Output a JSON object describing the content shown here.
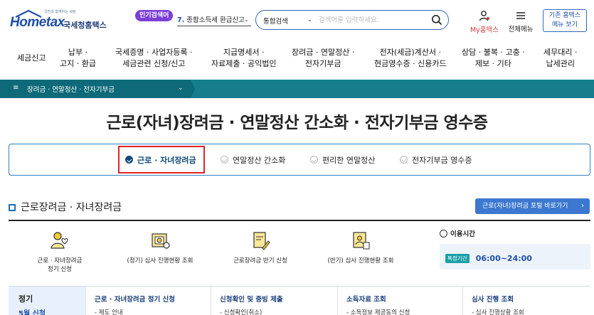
{
  "header": {
    "logo": {
      "tagline": "국민과 함께하는 세정",
      "brand_main": "Hometax",
      "brand_kr": "국세청홈택스"
    },
    "popular": {
      "badge": "인기검색어",
      "rank": "7.",
      "term": "종합소득세 환급신고",
      "chevron_icon": "chevron-down-icon"
    },
    "search": {
      "select_label": "통합검색",
      "placeholder": "검색어를 입력하세요.",
      "icon": "search-icon"
    },
    "mytax": {
      "label": "My홈택스",
      "icon": "user-icon"
    },
    "allmenu": {
      "label": "전체메뉴",
      "icon": "hamburger-icon"
    },
    "classic_button": {
      "line1": "기존 홈택스",
      "line2": "메뉴 보기"
    }
  },
  "mainnav": {
    "items": [
      {
        "line1": "세금신고",
        "line2": ""
      },
      {
        "line1": "납부 ·",
        "line2": "고지 · 환급"
      },
      {
        "line1": "국세증명 · 사업자등록 ·",
        "line2": "세금관련 신청/신고"
      },
      {
        "line1": "지급명세서 ·",
        "line2": "자료제출 · 공익법인"
      },
      {
        "line1": "장려금 · 연말정산 ·",
        "line2": "전자기부금"
      },
      {
        "line1": "전자(세금)계산서 ·",
        "line2": "현금영수증 · 신용카드"
      },
      {
        "line1": "상담 · 불복 · 고충 ·",
        "line2": "제보 · 기타"
      },
      {
        "line1": "세무대리 ·",
        "line2": "납세관리"
      }
    ]
  },
  "breadcrumb": {
    "menu_icon": "≡",
    "text": "장려금 · 연말정산 · 전자기부금",
    "chevron": "⌄"
  },
  "page_title": "근로(자녀)장려금 · 연말정산 간소화 · 전자기부금 영수증",
  "tabs": [
    {
      "label": "근로 · 자녀장려금",
      "active": true
    },
    {
      "label": "연말정산 간소화",
      "active": false
    },
    {
      "label": "편리한 연말정산",
      "active": false
    },
    {
      "label": "전자기부금 영수증",
      "active": false
    }
  ],
  "section": {
    "title": "근로장려금 · 자녀장려금",
    "shortcut_label": "근로(자녀)장려금 포털 바로가기",
    "shortcut_chevron": "›"
  },
  "services": [
    {
      "line1": "근로 · 자녀장려금",
      "line2": "정기 신청",
      "icon": "person-heart-icon"
    },
    {
      "line1": "(정기) 심사 진행현황 조회",
      "line2": "",
      "icon": "document-search-icon"
    },
    {
      "line1": "근로장려금 반기 신청",
      "line2": "",
      "icon": "document-pen-icon"
    },
    {
      "line1": "(반기) 심사 진행현황 조회",
      "line2": "",
      "icon": "document-person-icon"
    }
  ],
  "usage": {
    "title": "이용시간",
    "tag": "특정기간",
    "time": "06:00~24:00",
    "icon": "clock-icon"
  },
  "bottom": {
    "left": {
      "title": "정기",
      "period": "5월 신청"
    },
    "columns": [
      {
        "heading": "근로 · 자녀장려금 정기 신청",
        "sub": "- 제도 안내"
      },
      {
        "heading": "신청확인 및 증빙 제출",
        "sub": "- 신청확인(취소)"
      },
      {
        "heading": "소득자료 조회",
        "sub": "- 소득정보 제공동의 신청"
      },
      {
        "heading": "심사 진행 조회",
        "sub": "- 심사 진행상황 조회"
      }
    ]
  },
  "colors": {
    "brand_blue": "#1f4fa8",
    "teal_bar": "#157d8c",
    "badge_purple": "#7b3fd6",
    "highlight_red": "#e02424",
    "active_navy": "#114a7a"
  }
}
